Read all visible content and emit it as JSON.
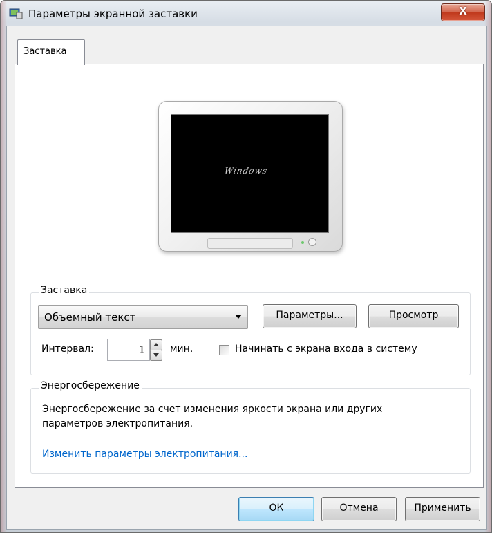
{
  "window": {
    "title": "Параметры экранной заставки",
    "close_label": "X"
  },
  "tabs": [
    {
      "label": "Заставка",
      "selected": true
    }
  ],
  "preview": {
    "screen_text": "Windows"
  },
  "screensaver_group": {
    "legend": "Заставка",
    "selected_screensaver": "Объемный текст",
    "settings_button": "Параметры...",
    "preview_button": "Просмотр",
    "interval_label": "Интервал:",
    "interval_value": "1",
    "interval_unit": "мин.",
    "logon_checkbox_label": "Начинать с экрана входа в систему",
    "logon_checked": false
  },
  "power_group": {
    "legend": "Энергосбережение",
    "description": "Энергосбережение за счет изменения яркости экрана или других параметров электропитания.",
    "link": "Изменить параметры электропитания..."
  },
  "footer": {
    "ok": "ОК",
    "cancel": "Отмена",
    "apply": "Применить"
  },
  "colors": {
    "link": "#0066cc",
    "close_button": "#c0391c",
    "screen_background": "#000000"
  }
}
